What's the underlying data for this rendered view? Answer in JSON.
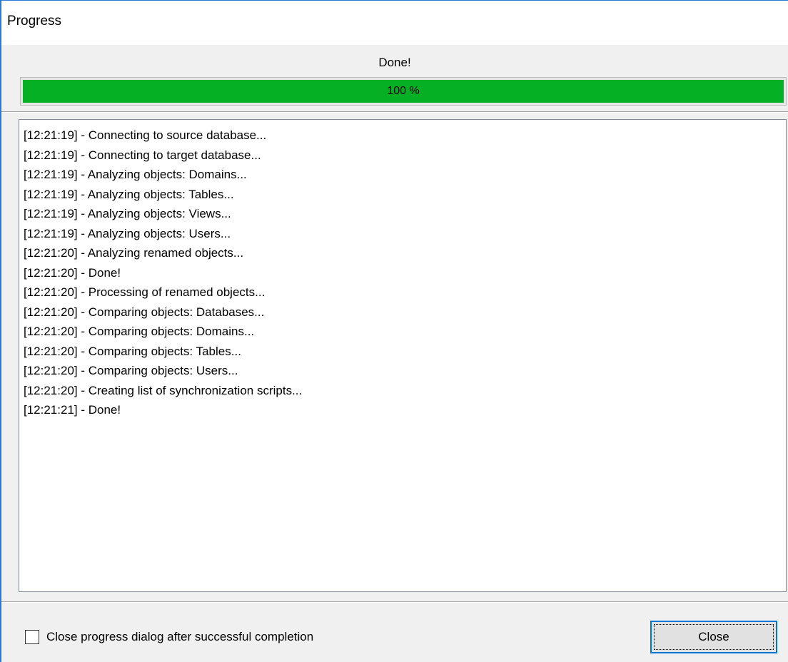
{
  "window": {
    "title": "Progress"
  },
  "status": {
    "label": "Done!"
  },
  "progress": {
    "value": 100,
    "text": "100 %",
    "fill_color": "#06b025"
  },
  "log": {
    "lines": [
      "[12:21:19] - Connecting to source database...",
      "[12:21:19] - Connecting to target database...",
      "[12:21:19] - Analyzing objects: Domains...",
      "[12:21:19] - Analyzing objects: Tables...",
      "[12:21:19] - Analyzing objects: Views...",
      "[12:21:19] - Analyzing objects: Users...",
      "[12:21:20] - Analyzing renamed objects...",
      "[12:21:20] - Done!",
      "[12:21:20] - Processing of renamed objects...",
      "[12:21:20] - Comparing objects: Databases...",
      "[12:21:20] - Comparing objects: Domains...",
      "[12:21:20] - Comparing objects: Tables...",
      "[12:21:20] - Comparing objects: Users...",
      "[12:21:20] - Creating list of synchronization scripts...",
      "[12:21:21] - Done!"
    ]
  },
  "footer": {
    "checkbox_label": "Close progress dialog after successful completion",
    "checkbox_checked": false,
    "close_label": "Close"
  },
  "colors": {
    "accent": "#0078d7",
    "window_border": "#2b79d6",
    "progress_green": "#06b025"
  }
}
